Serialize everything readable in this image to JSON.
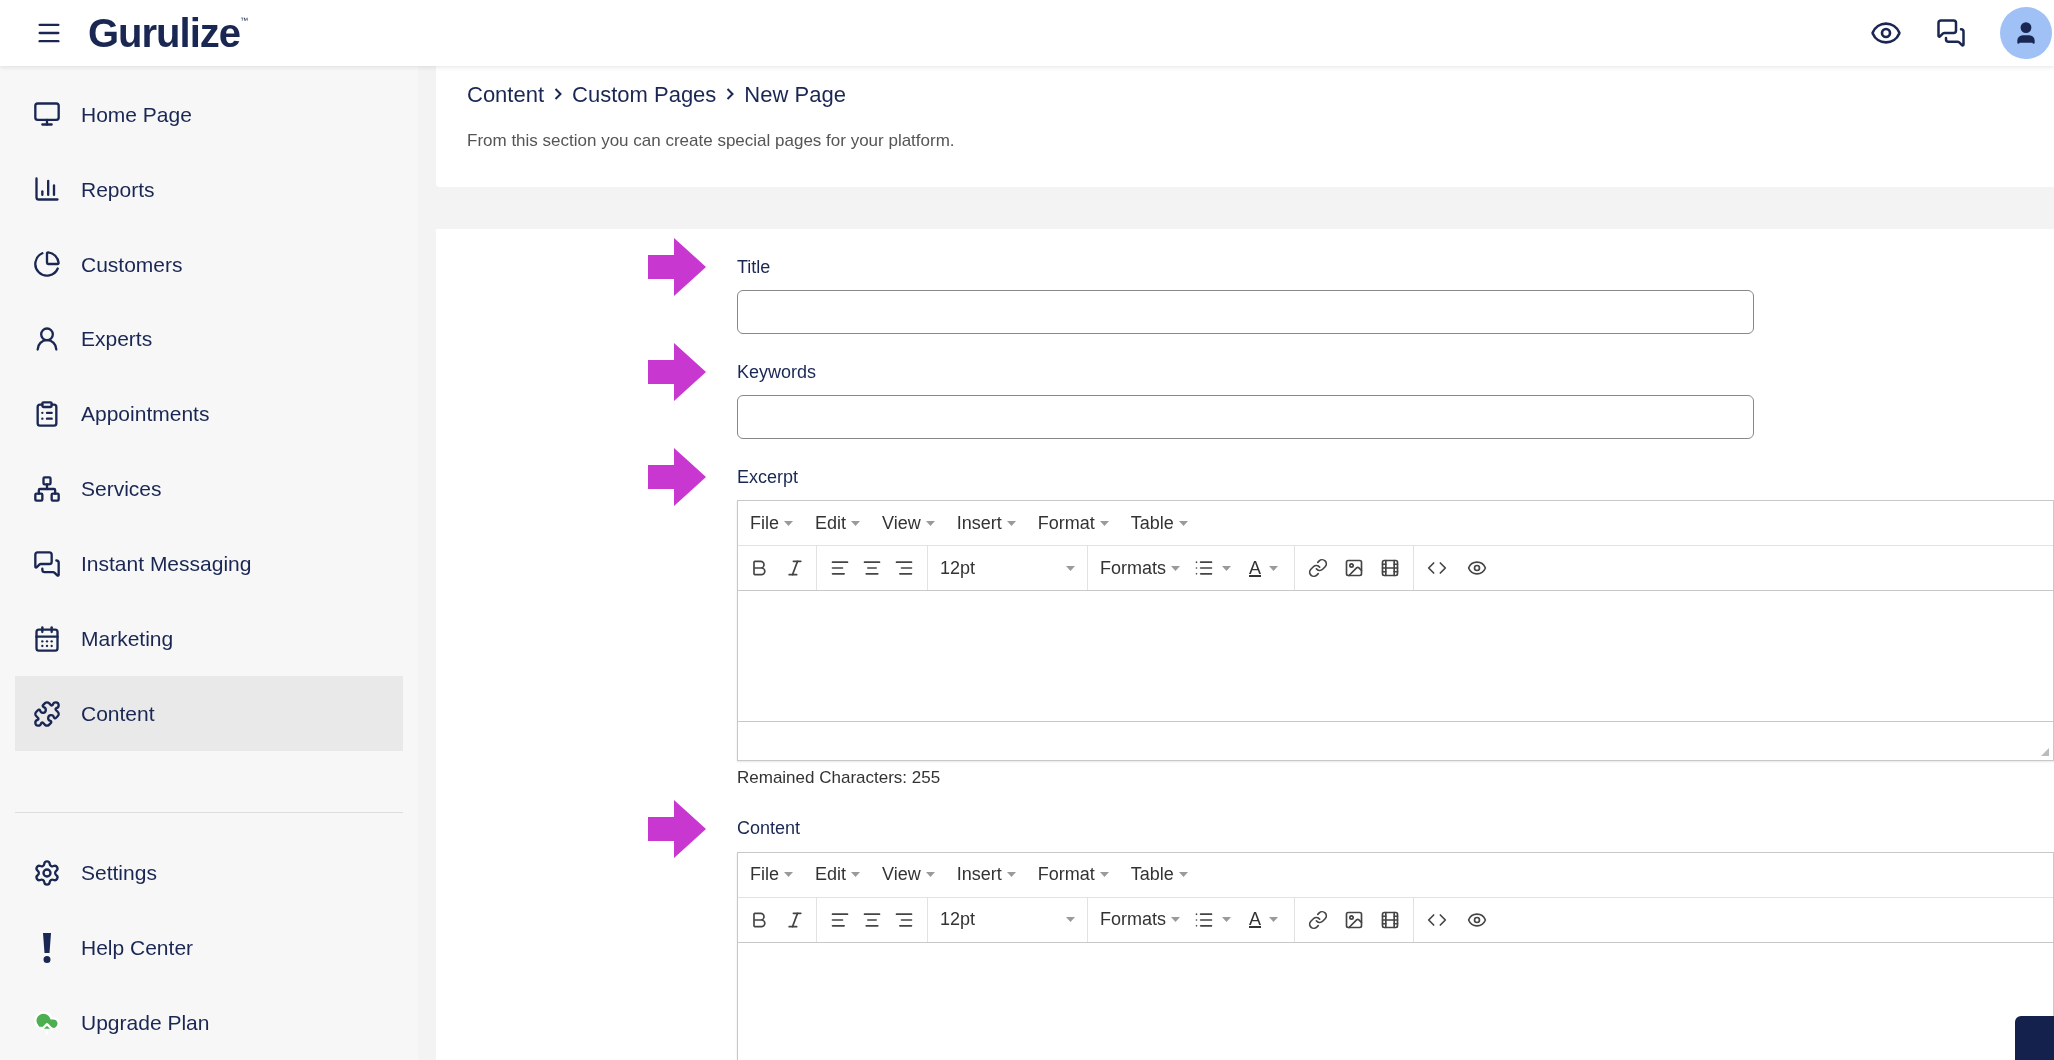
{
  "header": {
    "logo": "Gurulize",
    "logo_mark": "™"
  },
  "sidebar": {
    "items": [
      {
        "label": "Home Page",
        "selected": false
      },
      {
        "label": "Reports",
        "selected": false
      },
      {
        "label": "Customers",
        "selected": false
      },
      {
        "label": "Experts",
        "selected": false
      },
      {
        "label": "Appointments",
        "selected": false
      },
      {
        "label": "Services",
        "selected": false
      },
      {
        "label": "Instant Messaging",
        "selected": false
      },
      {
        "label": "Marketing",
        "selected": false
      },
      {
        "label": "Content",
        "selected": true
      }
    ],
    "bottom_items": [
      {
        "label": "Settings",
        "selected": false
      },
      {
        "label": "Help Center",
        "selected": false
      },
      {
        "label": "Upgrade Plan",
        "selected": false
      }
    ]
  },
  "breadcrumb": [
    {
      "label": "Content"
    },
    {
      "label": "Custom Pages"
    },
    {
      "label": "New Page"
    }
  ],
  "description": "From this section you can create special pages for your platform.",
  "form": {
    "fields": [
      {
        "kind": "input",
        "label": "Title",
        "arrow": true
      },
      {
        "kind": "input",
        "label": "Keywords",
        "arrow": true
      },
      {
        "kind": "editor",
        "label": "Excerpt",
        "arrow": true,
        "menus": [
          "File",
          "Edit",
          "View",
          "Insert",
          "Format",
          "Table"
        ],
        "font_size": "12pt",
        "formats": "Formats",
        "color_letter": "A",
        "status_bar": true,
        "counter": "Remained Characters: 255"
      },
      {
        "kind": "editor",
        "label": "Content",
        "arrow": true,
        "menus": [
          "File",
          "Edit",
          "View",
          "Insert",
          "Format",
          "Table"
        ],
        "font_size": "12pt",
        "formats": "Formats",
        "color_letter": "A",
        "status_bar": false
      }
    ]
  }
}
